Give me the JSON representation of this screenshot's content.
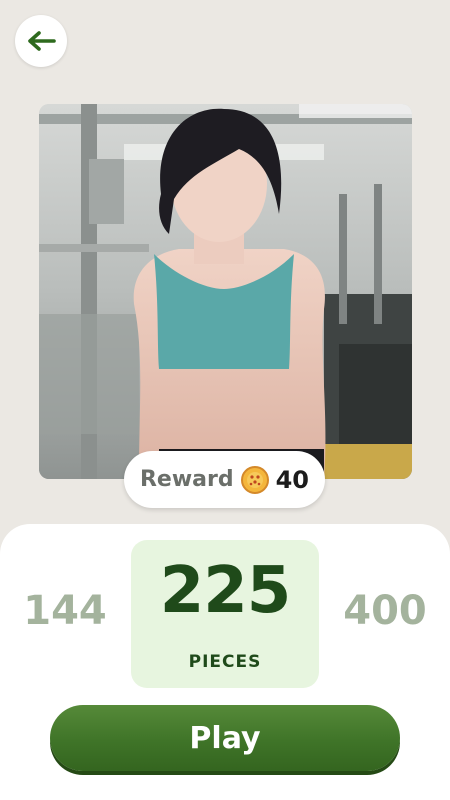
{
  "header": {
    "back_icon": "arrow-left-icon",
    "back_color": "#2e6a1e"
  },
  "puzzle": {
    "image_description": "photo",
    "reward": {
      "label": "Reward",
      "icon": "coin-icon",
      "value": "40"
    }
  },
  "piece_selector": {
    "options": [
      "144",
      "225",
      "400"
    ],
    "selected": "225",
    "unit_label": "PIECES"
  },
  "play_button": {
    "label": "Play",
    "color": "#3f7428"
  }
}
